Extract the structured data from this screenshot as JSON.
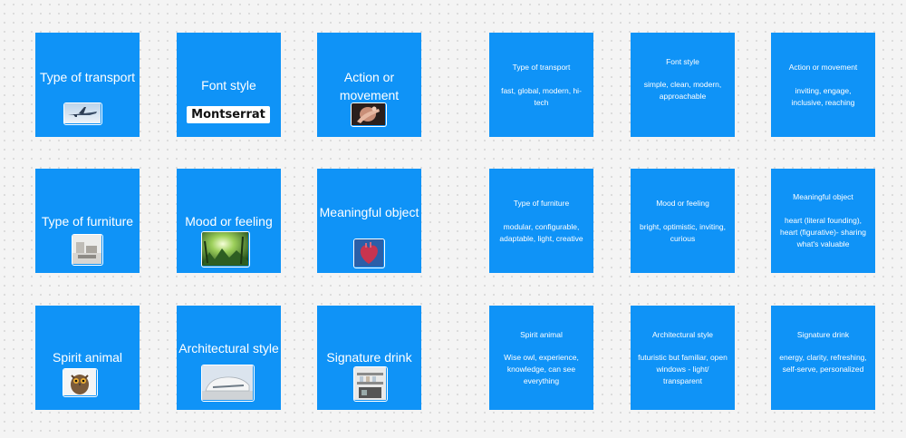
{
  "left_cards": {
    "transport": {
      "title": "Type of transport",
      "image": "airplane-photo"
    },
    "font": {
      "title": "Font style",
      "sample": "Montserrat"
    },
    "action": {
      "title": "Action or movement",
      "image": "reaching-hand-photo"
    },
    "furniture": {
      "title": "Type of furniture",
      "image": "modular-furniture-photo"
    },
    "mood": {
      "title": "Mood or feeling",
      "image": "sunlit-forest-photo"
    },
    "object": {
      "title": "Meaningful object",
      "image": "anatomical-heart-photo"
    },
    "animal": {
      "title": "Spirit animal",
      "image": "owl-photo"
    },
    "architecture": {
      "title": "Architectural style",
      "image": "futuristic-building-photo"
    },
    "drink": {
      "title": "Signature drink",
      "image": "self-serve-drink-station-photo"
    }
  },
  "right_cards": {
    "transport": {
      "title": "Type of transport",
      "description": "fast, global, modern, hi-tech"
    },
    "font": {
      "title": "Font style",
      "description": "simple, clean, modern, approachable"
    },
    "action": {
      "title": "Action or movement",
      "description": "inviting, engage, inclusive, reaching"
    },
    "furniture": {
      "title": "Type of furniture",
      "description": "modular, configurable, adaptable, light, creative"
    },
    "mood": {
      "title": "Mood or feeling",
      "description": "bright, optimistic, inviting, curious"
    },
    "object": {
      "title": "Meaningful object",
      "description": "heart (literal founding), heart (figurative)- sharing what's valuable"
    },
    "animal": {
      "title": "Spirit animal",
      "description": "Wise owl, experience, knowledge, can see everything"
    },
    "architecture": {
      "title": "Architectural style",
      "description": "futuristic but familiar, open windows - light/ transparent"
    },
    "drink": {
      "title": "Signature drink",
      "description": "energy, clarity, refreshing, self-serve, personalized"
    }
  },
  "colors": {
    "card": "#0f93f7",
    "canvas": "#f4f4f4",
    "text": "#ffffff"
  }
}
